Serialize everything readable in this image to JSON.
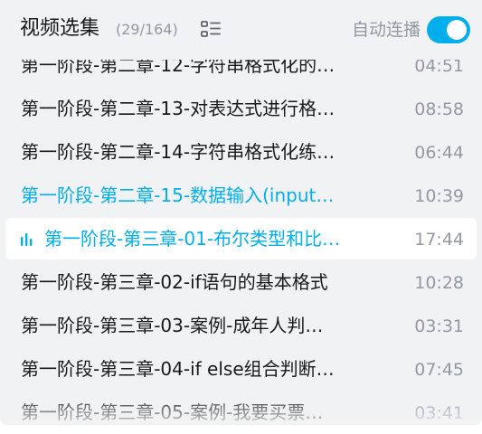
{
  "header": {
    "title": "视频选集",
    "count": "(29/164)",
    "autoplay_label": "自动连播",
    "autoplay_on": true
  },
  "episodes": [
    {
      "title": "第一阶段-第二章-12-字符串格式化的…",
      "duration": "04:51",
      "state": "normal"
    },
    {
      "title": "第一阶段-第二章-13-对表达式进行格…",
      "duration": "08:58",
      "state": "normal"
    },
    {
      "title": "第一阶段-第二章-14-字符串格式化练…",
      "duration": "06:44",
      "state": "normal"
    },
    {
      "title": "第一阶段-第二章-15-数据输入(input…",
      "duration": "10:39",
      "state": "watched"
    },
    {
      "title": "第一阶段-第三章-01-布尔类型和比…",
      "duration": "17:44",
      "state": "playing"
    },
    {
      "title": "第一阶段-第三章-02-if语句的基本格式",
      "duration": "10:28",
      "state": "normal"
    },
    {
      "title": "第一阶段-第三章-03-案例-成年人判…",
      "duration": "03:31",
      "state": "normal"
    },
    {
      "title": "第一阶段-第三章-04-if else组合判断…",
      "duration": "07:45",
      "state": "normal"
    },
    {
      "title": "第一阶段-第三章-05-案例-我要买票…",
      "duration": "03:41",
      "state": "normal"
    }
  ],
  "colors": {
    "accent": "#00aeec",
    "text": "#18191c",
    "muted": "#9499a0",
    "panel": "#f1f2f3"
  },
  "icons": {
    "list_mode": "list-view-icon",
    "playing": "playing-bars-icon"
  }
}
